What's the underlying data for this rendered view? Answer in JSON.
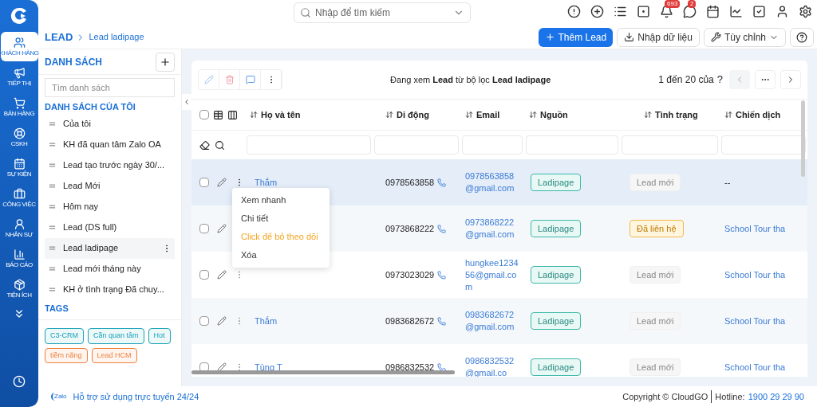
{
  "search": {
    "placeholder": "Nhập để tìm kiếm"
  },
  "top_icons": [
    {
      "kind": "alert"
    },
    {
      "kind": "add"
    },
    {
      "kind": "list"
    },
    {
      "kind": "note"
    },
    {
      "kind": "bell",
      "badge": "693"
    },
    {
      "kind": "chat",
      "badge": "2"
    },
    {
      "kind": "calendar"
    },
    {
      "kind": "chart"
    },
    {
      "kind": "task"
    },
    {
      "kind": "user"
    },
    {
      "kind": "settings"
    }
  ],
  "nav": [
    {
      "kind": "users",
      "label": "KHÁCH HÀNG",
      "selected": true
    },
    {
      "kind": "megaphone",
      "label": "TIẾP THỊ",
      "selected": false
    },
    {
      "kind": "cart",
      "label": "BÁN HÀNG",
      "selected": false
    },
    {
      "kind": "support",
      "label": "CSKH",
      "selected": false
    },
    {
      "kind": "calendar",
      "label": "SỰ KIỆN",
      "selected": false
    },
    {
      "kind": "briefcase",
      "label": "CÔNG VIỆC",
      "selected": false
    },
    {
      "kind": "user",
      "label": "NHÂN SỰ",
      "selected": false
    },
    {
      "kind": "report",
      "label": "BÁO CÁO",
      "selected": false
    },
    {
      "kind": "box",
      "label": "TIỆN ÍCH",
      "selected": false
    }
  ],
  "breadcrumb": [
    "LEAD",
    "Lead ladipage"
  ],
  "actions": [
    {
      "kind": "primary",
      "label": "Thêm Lead"
    },
    {
      "kind": "import",
      "label": "Nhập dữ liệu"
    },
    {
      "kind": "custom",
      "label": "Tùy chỉnh"
    }
  ],
  "lists_panel": {
    "title": "DANH SÁCH",
    "search_placeholder": "Tìm danh sách",
    "section": "DANH SÁCH CỦA TÔI",
    "items": [
      {
        "label": "Của tôi",
        "selected": false
      },
      {
        "label": "KH đã quan tâm Zalo OA",
        "selected": false
      },
      {
        "label": "Lead tạo trước ngày 30/...",
        "selected": false
      },
      {
        "label": "Lead Mới",
        "selected": false
      },
      {
        "label": "Hôm nay",
        "selected": false
      },
      {
        "label": "Lead (DS full)",
        "selected": false
      },
      {
        "label": "Lead ladipage",
        "selected": true
      },
      {
        "label": "Lead mới tháng này",
        "selected": false
      },
      {
        "label": "KH ở tình trạng Đã chuy...",
        "selected": false
      }
    ],
    "tags_title": "TAGS",
    "tags": [
      {
        "label": "C3-CRM",
        "color": "#17a2b8"
      },
      {
        "label": "Cần quan tâm",
        "color": "#17a2b8"
      },
      {
        "label": "Hot",
        "color": "#17a2b8"
      },
      {
        "label": "tiềm năng",
        "color": "#f0803c"
      },
      {
        "label": "Lead HCM",
        "color": "#f0803c"
      }
    ]
  },
  "toolbar": {
    "summary": "Đang xem **Lead** từ bộ lọc **Lead ladipage**",
    "paging": "1 đến 20 của",
    "unknown": "?"
  },
  "table": {
    "all_checked": false,
    "columns": [
      "Họ và tên",
      "Di động",
      "Email",
      "Nguồn",
      "Tình trạng",
      "Chiến dịch"
    ],
    "rows": [
      {
        "selected": true,
        "name": "Thắm",
        "phone": "0978563858",
        "email": "0978563858@gmail.com",
        "source": "Ladipage",
        "status": {
          "label": "Lead mới",
          "kind": "new"
        },
        "campaign": "--"
      },
      {
        "selected": false,
        "phone": "0973868222",
        "email": "0973868222@gmail.com",
        "source": "Ladipage",
        "status": {
          "label": "Đã liên hệ",
          "kind": "contacted"
        },
        "campaign": "School Tour tha"
      },
      {
        "selected": false,
        "phone": "0973023029",
        "email": "hungkee123456@gmail.com",
        "source": "Ladipage",
        "status": {
          "label": "Lead mới",
          "kind": "new"
        },
        "campaign": "School Tour tha"
      },
      {
        "selected": false,
        "name": "Thắm",
        "phone": "0983682672",
        "email": "0983682672@gmail.com",
        "source": "Ladipage",
        "status": {
          "label": "Lead mới",
          "kind": "new"
        },
        "campaign": "School Tour tha"
      },
      {
        "selected": false,
        "name": "Tùng T",
        "phone": "0986832532",
        "email": "0986832532@gmail.co",
        "source": "Ladipage",
        "status": {
          "label": "Lead mới",
          "kind": "new"
        },
        "campaign": "School Tour tha"
      }
    ]
  },
  "row_menu": [
    {
      "label": "Xem nhanh",
      "kind": "normal"
    },
    {
      "label": "Chi tiết",
      "kind": "normal"
    },
    {
      "label": "Click để bỏ theo dõi",
      "kind": "warning"
    },
    {
      "label": "Xóa",
      "kind": "normal"
    }
  ],
  "footer": {
    "support": "Hỗ trợ sử dụng trực tuyến 24/24",
    "zalo": "Zalo",
    "copyright": "Copyright © CloudGO",
    "hotline_label": "Hotline:",
    "hotline": "1900 29 29 90"
  }
}
